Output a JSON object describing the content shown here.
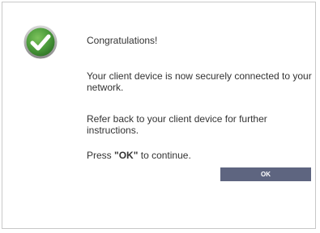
{
  "dialog": {
    "title": "Congratulations!",
    "message_connected": "Your client device is now securely connected to your network.",
    "message_refer": "Refer back to your client device for further instructions.",
    "press_prefix": "Press ",
    "press_key": "\"OK\"",
    "press_suffix": " to continue.",
    "ok_label": "OK"
  },
  "icon": {
    "name": "checkmark-success-icon",
    "fill_color": "#4a9a3a",
    "ring_color": "#9a9a9a"
  }
}
